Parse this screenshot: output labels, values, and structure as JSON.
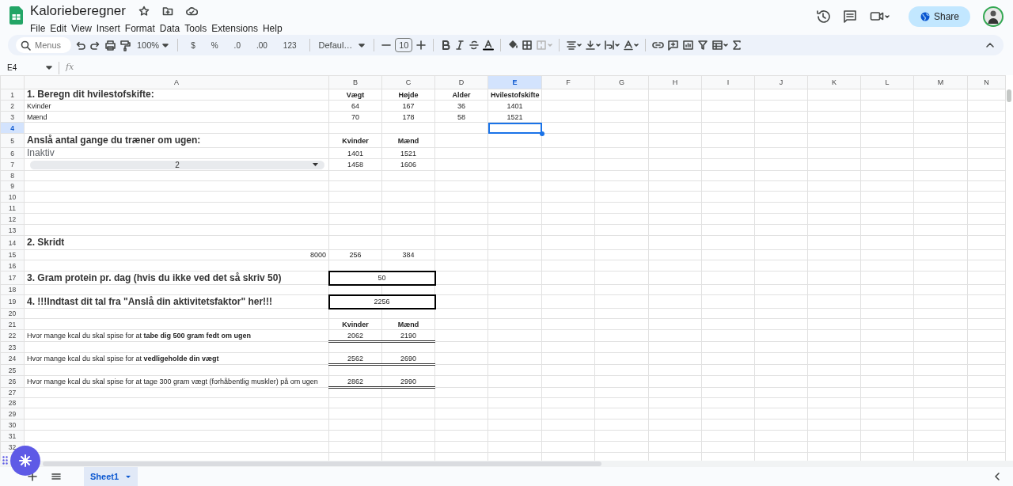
{
  "document": {
    "title": "Kalorieberegner"
  },
  "menus": [
    "File",
    "Edit",
    "View",
    "Insert",
    "Format",
    "Data",
    "Tools",
    "Extensions",
    "Help"
  ],
  "share_button": {
    "label": "Share"
  },
  "toolbar": {
    "search_placeholder": "Menus",
    "zoom": "100%",
    "currency": "$",
    "percent": "%",
    "decrease_decimals": ".0",
    "increase_decimals": ".00",
    "more_formats": "123",
    "font": "Defaul…",
    "font_size": "10"
  },
  "formula_bar": {
    "cell_reference": "E4",
    "fx": "fx"
  },
  "columns": [
    {
      "label": "A",
      "selected": false
    },
    {
      "label": "B",
      "selected": false
    },
    {
      "label": "C",
      "selected": false
    },
    {
      "label": "D",
      "selected": false
    },
    {
      "label": "E",
      "selected": true
    },
    {
      "label": "F",
      "selected": false
    },
    {
      "label": "G",
      "selected": false
    },
    {
      "label": "H",
      "selected": false
    },
    {
      "label": "I",
      "selected": false
    },
    {
      "label": "J",
      "selected": false
    },
    {
      "label": "K",
      "selected": false
    },
    {
      "label": "L",
      "selected": false
    },
    {
      "label": "M",
      "selected": false
    },
    {
      "label": "N",
      "selected": false
    }
  ],
  "rows": [
    {
      "number": "1",
      "selected": false,
      "cells": {
        "A": {
          "kind": "title",
          "text": "1. Beregn dit hvilestofskifte:"
        },
        "B": {
          "kind": "header",
          "text": "Vægt"
        },
        "C": {
          "kind": "header",
          "text": "Højde"
        },
        "D": {
          "kind": "header",
          "text": "Alder"
        },
        "E": {
          "kind": "header",
          "text": "Hvilestofskifte"
        }
      }
    },
    {
      "number": "2",
      "selected": false,
      "cells": {
        "A": {
          "kind": "text",
          "text": "Kvinder"
        },
        "B": {
          "kind": "number",
          "text": "64"
        },
        "C": {
          "kind": "number",
          "text": "167"
        },
        "D": {
          "kind": "number",
          "text": "36"
        },
        "E": {
          "kind": "number",
          "text": "1401"
        }
      }
    },
    {
      "number": "3",
      "selected": false,
      "cells": {
        "A": {
          "kind": "text",
          "text": "Mænd"
        },
        "B": {
          "kind": "number",
          "text": "70"
        },
        "C": {
          "kind": "number",
          "text": "178"
        },
        "D": {
          "kind": "number",
          "text": "58"
        },
        "E": {
          "kind": "number",
          "text": "1521"
        }
      }
    },
    {
      "number": "4",
      "selected": true,
      "cells": {}
    },
    {
      "number": "5",
      "selected": false,
      "cells": {
        "A": {
          "kind": "title",
          "text": "Anslå antal gange du træner om ugen:"
        },
        "B": {
          "kind": "header",
          "text": "Kvinder"
        },
        "C": {
          "kind": "header",
          "text": "Mænd"
        }
      }
    },
    {
      "number": "6",
      "selected": false,
      "cells": {
        "A": {
          "kind": "large",
          "text": "Inaktiv"
        },
        "B": {
          "kind": "number",
          "text": "1401"
        },
        "C": {
          "kind": "number",
          "text": "1521"
        }
      }
    },
    {
      "number": "7",
      "selected": false,
      "cells": {
        "A": {
          "kind": "dropdown",
          "text": "2"
        },
        "B": {
          "kind": "number",
          "text": "1458"
        },
        "C": {
          "kind": "number",
          "text": "1606"
        }
      }
    },
    {
      "number": "8",
      "selected": false,
      "cells": {}
    },
    {
      "number": "9",
      "selected": false,
      "cells": {}
    },
    {
      "number": "10",
      "selected": false,
      "cells": {}
    },
    {
      "number": "11",
      "selected": false,
      "cells": {}
    },
    {
      "number": "12",
      "selected": false,
      "cells": {}
    },
    {
      "number": "13",
      "selected": false,
      "cells": {}
    },
    {
      "number": "14",
      "selected": false,
      "cells": {
        "A": {
          "kind": "title",
          "text": "2. Skridt"
        }
      }
    },
    {
      "number": "15",
      "selected": false,
      "cells": {
        "A": {
          "kind": "number_right",
          "text": "8000"
        },
        "B": {
          "kind": "number",
          "text": "256"
        },
        "C": {
          "kind": "number",
          "text": "384"
        }
      }
    },
    {
      "number": "16",
      "selected": false,
      "cells": {}
    },
    {
      "number": "17",
      "selected": false,
      "cells": {
        "A": {
          "kind": "title",
          "text": "3. Gram protein pr. dag (hvis du ikke ved det så skriv 50)"
        },
        "B": {
          "kind": "box",
          "text": "50"
        }
      }
    },
    {
      "number": "18",
      "selected": false,
      "cells": {}
    },
    {
      "number": "19",
      "selected": false,
      "cells": {
        "A": {
          "kind": "title",
          "text": "4. !!!Indtast dit tal fra \"Anslå din aktivitetsfaktor\" her!!!"
        },
        "B": {
          "kind": "box",
          "text": "2256"
        }
      }
    },
    {
      "number": "20",
      "selected": false,
      "cells": {}
    },
    {
      "number": "21",
      "selected": false,
      "cells": {
        "B": {
          "kind": "header",
          "text": "Kvinder"
        },
        "C": {
          "kind": "header",
          "text": "Mænd"
        }
      }
    },
    {
      "number": "22",
      "selected": false,
      "cells": {
        "A": {
          "kind": "text",
          "text": "Hvor mange kcal du skal spise for at **tabe dig 500 gram fedt om ugen**"
        },
        "B": {
          "kind": "total",
          "text": "2062"
        },
        "C": {
          "kind": "total",
          "text": "2190"
        }
      }
    },
    {
      "number": "23",
      "selected": false,
      "cells": {}
    },
    {
      "number": "24",
      "selected": false,
      "cells": {
        "A": {
          "kind": "text",
          "text": "Hvor mange kcal du skal spise for at **vedligeholde din vægt**"
        },
        "B": {
          "kind": "total",
          "text": "2562"
        },
        "C": {
          "kind": "total",
          "text": "2690"
        }
      }
    },
    {
      "number": "25",
      "selected": false,
      "cells": {}
    },
    {
      "number": "26",
      "selected": false,
      "cells": {
        "A": {
          "kind": "text",
          "text": "Hvor mange kcal du skal spise for at tage 300 gram vægt (forhåbentlig muskler) på om ugen"
        },
        "B": {
          "kind": "total",
          "text": "2862"
        },
        "C": {
          "kind": "total",
          "text": "2990"
        }
      }
    },
    {
      "number": "27",
      "selected": false,
      "cells": {}
    },
    {
      "number": "28",
      "selected": false,
      "cells": {}
    },
    {
      "number": "29",
      "selected": false,
      "cells": {}
    },
    {
      "number": "30",
      "selected": false,
      "cells": {}
    },
    {
      "number": "31",
      "selected": false,
      "cells": {}
    },
    {
      "number": "32",
      "selected": false,
      "cells": {}
    }
  ],
  "sheet_tabs": [
    {
      "label": "Sheet1",
      "selected": true
    }
  ]
}
